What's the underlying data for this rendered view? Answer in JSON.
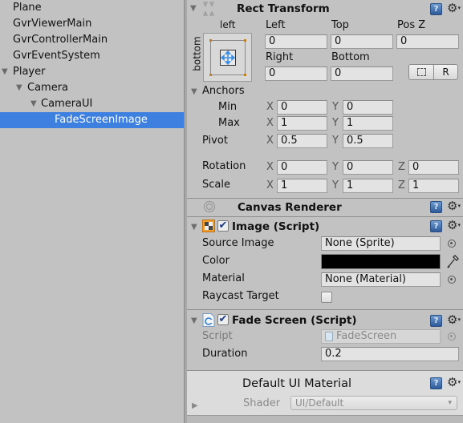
{
  "hierarchy": {
    "items": [
      {
        "label": "Plane",
        "expanded": null,
        "selected": false
      },
      {
        "label": "GvrViewerMain",
        "expanded": null,
        "selected": false
      },
      {
        "label": "GvrControllerMain",
        "expanded": null,
        "selected": false
      },
      {
        "label": "GvrEventSystem",
        "expanded": null,
        "selected": false
      },
      {
        "label": "Player",
        "expanded": true,
        "selected": false
      },
      {
        "label": "Camera",
        "expanded": true,
        "selected": false
      },
      {
        "label": "CameraUI",
        "expanded": true,
        "selected": false
      },
      {
        "label": "FadeScreenImage",
        "expanded": null,
        "selected": true
      }
    ],
    "selection_color": "#3d80df"
  },
  "icons": {
    "expand": "▼",
    "collapsed": "▶",
    "help": "?",
    "gear": "⚙",
    "gear_caret": "▾",
    "check": "✔",
    "blueprint": "⬚",
    "dropdown": "▾"
  },
  "rect_transform": {
    "title": "Rect Transform",
    "anchor_preset": {
      "top_label": "left",
      "side_label": "bottom"
    },
    "labels": {
      "left": "Left",
      "top": "Top",
      "pos_z": "Pos Z",
      "right": "Right",
      "bottom": "Bottom"
    },
    "values": {
      "left": "0",
      "top": "0",
      "pos_z": "0",
      "right": "0",
      "bottom": "0"
    },
    "raw_button": "R",
    "anchors": {
      "label": "Anchors",
      "min_label": "Min",
      "min_x": "0",
      "min_y": "0",
      "max_label": "Max",
      "max_x": "1",
      "max_y": "1"
    },
    "pivot": {
      "label": "Pivot",
      "x": "0.5",
      "y": "0.5"
    },
    "rotation": {
      "label": "Rotation",
      "x": "0",
      "y": "0",
      "z": "0"
    },
    "scale": {
      "label": "Scale",
      "x": "1",
      "y": "1",
      "z": "1"
    },
    "axis": {
      "x": "X",
      "y": "Y",
      "z": "Z"
    }
  },
  "canvas_renderer": {
    "title": "Canvas Renderer"
  },
  "image_script": {
    "title": "Image (Script)",
    "enabled": true,
    "source_image": {
      "label": "Source Image",
      "value": "None (Sprite)"
    },
    "color": {
      "label": "Color",
      "value": "#000000"
    },
    "material": {
      "label": "Material",
      "value": "None (Material)"
    },
    "raycast_target": {
      "label": "Raycast Target",
      "checked": false
    }
  },
  "fade_screen": {
    "title": "Fade Screen (Script)",
    "enabled": true,
    "script": {
      "label": "Script",
      "value": "FadeScreen"
    },
    "duration": {
      "label": "Duration",
      "value": "0.2"
    }
  },
  "material_preview": {
    "title": "Default UI Material",
    "shader_label": "Shader",
    "shader_value": "UI/Default"
  }
}
